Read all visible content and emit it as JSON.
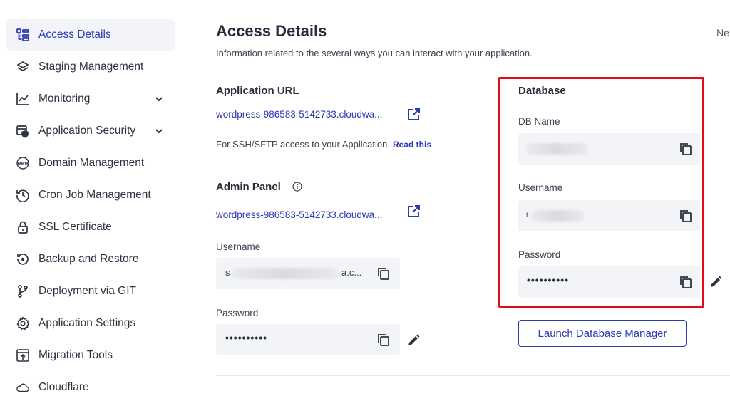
{
  "sidebar": {
    "items": [
      {
        "label": "Access Details",
        "icon": "access-details-icon",
        "active": true
      },
      {
        "label": "Staging Management",
        "icon": "layers-icon"
      },
      {
        "label": "Monitoring",
        "icon": "chart-line-icon",
        "expandable": true
      },
      {
        "label": "Application Security",
        "icon": "shield-icon",
        "expandable": true
      },
      {
        "label": "Domain Management",
        "icon": "www-icon"
      },
      {
        "label": "Cron Job Management",
        "icon": "clock-history-icon"
      },
      {
        "label": "SSL Certificate",
        "icon": "lock-icon"
      },
      {
        "label": "Backup and Restore",
        "icon": "backup-icon"
      },
      {
        "label": "Deployment via GIT",
        "icon": "git-branch-icon"
      },
      {
        "label": "Application Settings",
        "icon": "gear-icon"
      },
      {
        "label": "Migration Tools",
        "icon": "migration-icon"
      },
      {
        "label": "Cloudflare",
        "icon": "cloud-icon"
      }
    ]
  },
  "header": {
    "title": "Access Details",
    "subtitle": "Information related to the several ways you can interact with your application.",
    "truncated_right": "Ne"
  },
  "app_url": {
    "heading": "Application URL",
    "url": "wordpress-986583-5142733.cloudwa...",
    "ssh_note": "For SSH/SFTP access to your Application.",
    "read_this": "Read this"
  },
  "admin_panel": {
    "heading": "Admin Panel",
    "url": "wordpress-986583-5142733.cloudwa...",
    "username_label": "Username",
    "username_prefix": "s",
    "username_suffix": "a.c...",
    "password_label": "Password",
    "password_value": "••••••••••"
  },
  "database": {
    "heading": "Database",
    "db_name_label": "DB Name",
    "username_label": "Username",
    "username_prefix": "r",
    "password_label": "Password",
    "password_value": "••••••••••",
    "launch_button": "Launch Database Manager"
  },
  "colors": {
    "accent": "#2a3ab0",
    "highlight": "#e30b17",
    "field_bg": "#f2f4f7"
  }
}
